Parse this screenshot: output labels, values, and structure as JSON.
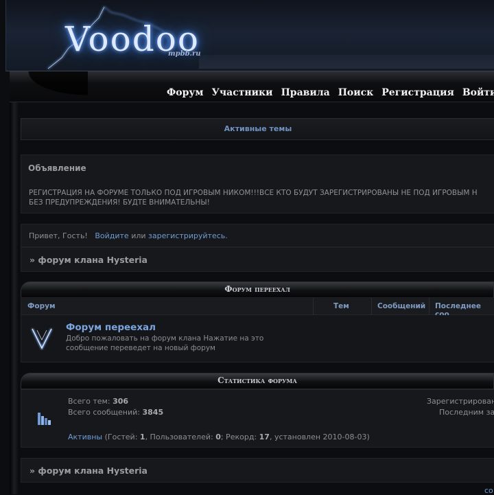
{
  "header": {
    "logo_text": "Voodoo",
    "logo_site": "mpbb.ru"
  },
  "nav": {
    "items": [
      "Форум",
      "Участники",
      "Правила",
      "Поиск",
      "Регистрация",
      "Войти"
    ]
  },
  "active_topics": {
    "label": "Активные темы"
  },
  "announcement": {
    "title": "Объявление",
    "line1": "РЕГИСТРАЦИЯ НА ФОРУМЕ ТОЛЬКО ПОД ИГРОВЫМ НИКОМ!!!ВСЕ КТО БУДУТ ЗАРЕГИСТРИРОВАНЫ НЕ ПОД ИГРОВЫМ Н",
    "line2": "БЕЗ ПРЕДУПРЕЖДЕНИЯ! БУДТЕ ВНИМАТЕЛЬНЫ!"
  },
  "guest": {
    "greeting": "Привет, Гость!",
    "login": "Войдите",
    "or": "или",
    "register": "зарегистрируйтесь",
    "end": "."
  },
  "breadcrumb": {
    "text": "» форум клана Hysteria"
  },
  "category": {
    "title": "Форум переехал",
    "columns": [
      "Форум",
      "Тем",
      "Сообщений",
      "Последнее соо"
    ],
    "forum": {
      "name": "Форум переехал",
      "description": "Добро пожаловать на форум клана Нажатие на это сообщение переведет на новый форум"
    }
  },
  "stats": {
    "title": "Статистика форума",
    "topics_label": "Всего тем:",
    "topics_value": "306",
    "posts_label": "Всего сообщений:",
    "posts_value": "3845",
    "registered_label": "Зарегистрирован",
    "last_label": "Последним за",
    "active_link": "Активны",
    "guests_label": "(Гостей:",
    "guests_value": "1",
    "users_label": ", Пользователей:",
    "users_value": "0",
    "record_label": "; Рекорд:",
    "record_value": "17",
    "record_date": ", установлен 2010-08-03)"
  },
  "breadcrumb_bottom": {
    "text": "» форум клана Hysteria"
  },
  "bottom_link": "со"
}
